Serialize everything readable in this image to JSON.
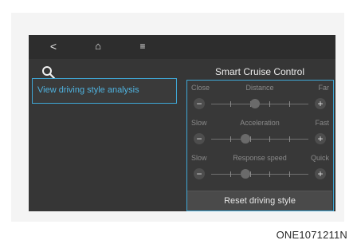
{
  "screen": {
    "title": "Smart Cruise Control",
    "nav": {
      "back": "<",
      "home": "⌂",
      "menu": "≡"
    },
    "menu_item": "View driving style analysis",
    "settings": [
      {
        "left": "Close",
        "center": "Distance",
        "right": "Far",
        "level": 0.45,
        "ticks": 5
      },
      {
        "left": "Slow",
        "center": "Acceleration",
        "right": "Fast",
        "level": 0.35,
        "ticks": 5
      },
      {
        "left": "Slow",
        "center": "Response speed",
        "right": "Quick",
        "level": 0.35,
        "ticks": 5
      }
    ],
    "minus_symbol": "−",
    "plus_symbol": "+",
    "reset_label": "Reset driving style"
  },
  "caption": "ONE1071211N",
  "colors": {
    "accent": "#3fa7d6",
    "screen_bg": "#363636"
  },
  "icons": {
    "search": "search-icon"
  }
}
